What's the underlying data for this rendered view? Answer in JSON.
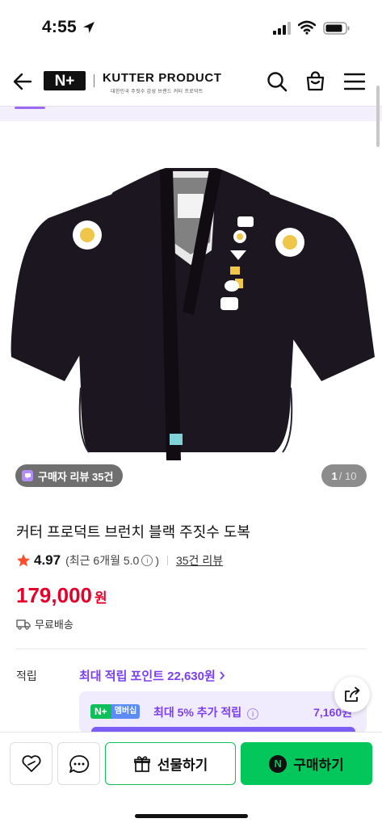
{
  "status_bar": {
    "time": "4:55"
  },
  "header": {
    "logo_text": "N+",
    "brand_name": "KUTTER PRODUCT",
    "brand_sub": "대한민국 주짓수 감성 브랜드 커터 프로덕트",
    "icons": [
      "back-arrow-icon",
      "search-icon",
      "shopping-bag-icon",
      "menu-icon"
    ]
  },
  "gallery": {
    "review_chip": "구매자 리뷰 35건",
    "page_current": "1",
    "page_total": "/ 10"
  },
  "product": {
    "title": "커터 프로덕트 브런치 블랙 주짓수 도복",
    "rating": "4.97",
    "rating_recent_prefix": "(최근 6개월 5.0",
    "rating_recent_suffix": ")",
    "review_link": "35건 리뷰",
    "price": "179,000",
    "price_unit": "원",
    "shipping": "무료배송"
  },
  "points": {
    "label": "적립",
    "max_points": "최대 적립 포인트 22,630원",
    "member_badge_n": "N+",
    "member_badge_text": "멤버십",
    "member_text": "최대 5% 추가 적립",
    "member_amount": "7,160원"
  },
  "bottom_bar": {
    "gift_label": "선물하기",
    "buy_label": "구매하기",
    "buy_icon_text": "N"
  },
  "colors": {
    "price_red": "#e4002b",
    "point_purple": "#7a3ff2",
    "naver_green": "#03c75a",
    "gi_black": "#1c1620"
  }
}
